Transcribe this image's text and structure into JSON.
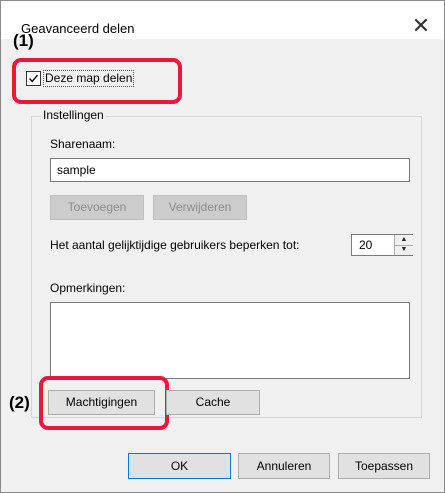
{
  "window": {
    "title": "Geavanceerd delen",
    "close_glyph": "✕"
  },
  "callouts": {
    "one": "(1)",
    "two": "(2)",
    "color": "#e8193c"
  },
  "share_checkbox": {
    "label": "Deze map delen",
    "checked": true
  },
  "settings": {
    "group_label": "Instellingen",
    "share_name_label": "Sharenaam:",
    "share_name_value": "sample",
    "add_button": "Toevoegen",
    "remove_button": "Verwijderen",
    "user_limit_label": "Het aantal gelijktijdige gebruikers beperken tot:",
    "user_limit_value": "20",
    "comments_label": "Opmerkingen:",
    "comments_value": "",
    "permissions_button": "Machtigingen",
    "cache_button": "Cache"
  },
  "footer": {
    "ok": "OK",
    "cancel": "Annuleren",
    "apply": "Toepassen"
  }
}
